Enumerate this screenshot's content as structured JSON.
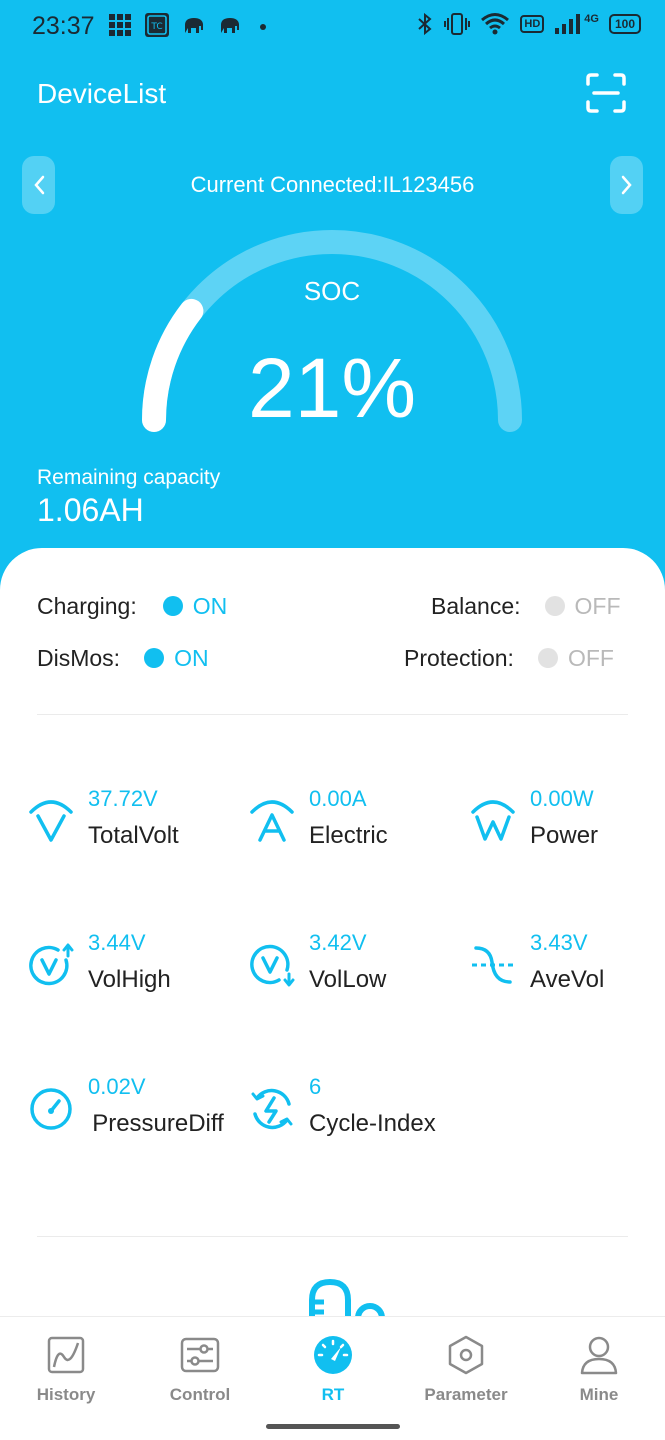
{
  "status_bar": {
    "time": "23:37",
    "network": "4G",
    "battery": "100",
    "hd": "HD"
  },
  "header": {
    "title": "DeviceList",
    "connected_text": "Current Connected:IL123456"
  },
  "gauge": {
    "label": "SOC",
    "value_text": "21%",
    "percent": 21
  },
  "capacity": {
    "label": "Remaining capacity",
    "value": "1.06AH"
  },
  "status": {
    "charging": {
      "label": "Charging:",
      "state": "ON"
    },
    "balance": {
      "label": "Balance:",
      "state": "OFF"
    },
    "dismos": {
      "label": "DisMos:",
      "state": "ON"
    },
    "protection": {
      "label": "Protection:",
      "state": "OFF"
    }
  },
  "metrics": [
    {
      "value": "37.72V",
      "label": "TotalVolt",
      "icon": "total-volt-icon"
    },
    {
      "value": "0.00A",
      "label": "Electric",
      "icon": "current-icon"
    },
    {
      "value": "0.00W",
      "label": "Power",
      "icon": "power-icon"
    },
    {
      "value": "3.44V",
      "label": "VolHigh",
      "icon": "vol-high-icon"
    },
    {
      "value": "3.42V",
      "label": "VolLow",
      "icon": "vol-low-icon"
    },
    {
      "value": "3.43V",
      "label": "AveVol",
      "icon": "ave-vol-icon"
    },
    {
      "value": "0.02V",
      "label": "PressureDiff",
      "icon": "gauge-icon"
    },
    {
      "value": "6",
      "label": "Cycle-Index",
      "icon": "cycle-icon"
    }
  ],
  "tabs": [
    {
      "label": "History",
      "icon": "chart-icon"
    },
    {
      "label": "Control",
      "icon": "sliders-icon"
    },
    {
      "label": "RT",
      "icon": "speedometer-icon"
    },
    {
      "label": "Parameter",
      "icon": "hexagon-icon"
    },
    {
      "label": "Mine",
      "icon": "user-icon"
    }
  ],
  "colors": {
    "accent": "#11bff0",
    "off": "#e2e2e2",
    "text": "#222222"
  }
}
